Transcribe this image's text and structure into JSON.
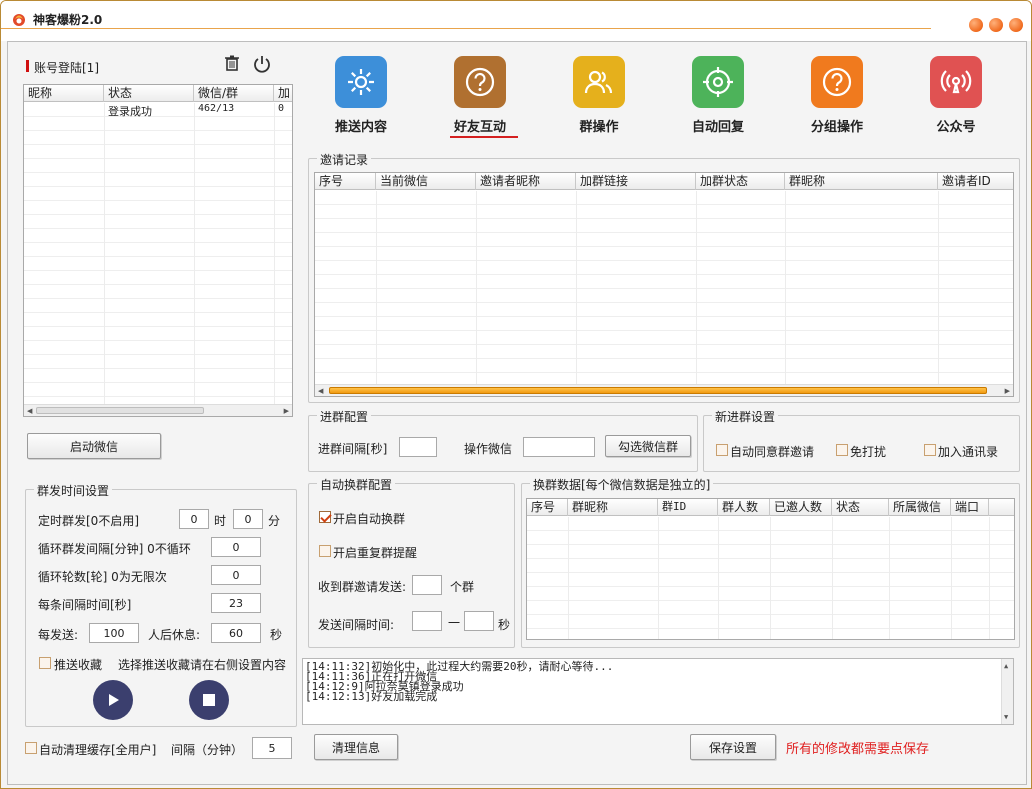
{
  "app": {
    "title": "神客爆粉2.0"
  },
  "account": {
    "label": "账号登陆[1]",
    "columns": [
      "昵称",
      "状态",
      "微信/群",
      "加"
    ],
    "rows": [
      [
        "",
        "登录成功",
        "462/13",
        "0"
      ]
    ],
    "start_button": "启动微信"
  },
  "nav": [
    {
      "label": "推送内容",
      "icon": "gear-icon",
      "color": "#3d8fd9"
    },
    {
      "label": "好友互动",
      "icon": "question-icon",
      "color": "#b07030",
      "active": true
    },
    {
      "label": "群操作",
      "icon": "group-icon",
      "color": "#e5b01c"
    },
    {
      "label": "自动回复",
      "icon": "target-icon",
      "color": "#4db35a"
    },
    {
      "label": "分组操作",
      "icon": "question-icon",
      "color": "#f07a1e"
    },
    {
      "label": "公众号",
      "icon": "broadcast-icon",
      "color": "#e05252"
    }
  ],
  "invite_log": {
    "title": "邀请记录",
    "columns": [
      "序号",
      "当前微信",
      "邀请者昵称",
      "加群链接",
      "加群状态",
      "群昵称",
      "邀请者ID"
    ]
  },
  "join_config": {
    "title": "进群配置",
    "interval_label": "进群间隔[秒]",
    "interval_value": "",
    "wechat_label": "操作微信",
    "wechat_value": "",
    "select_button": "勾选微信群"
  },
  "new_group": {
    "title": "新进群设置",
    "options": [
      {
        "label": "自动同意群邀请",
        "checked": false
      },
      {
        "label": "免打扰",
        "checked": false
      },
      {
        "label": "加入通讯录",
        "checked": false
      }
    ]
  },
  "schedule": {
    "title": "群发时间设置",
    "timed_label": "定时群发[0不启用]",
    "hour_value": "0",
    "hour_unit": "时",
    "minute_value": "0",
    "minute_unit": "分",
    "loop_interval_label": "循环群发间隔[分钟] 0不循环",
    "loop_interval_value": "0",
    "loop_rounds_label": "循环轮数[轮] 0为无限次",
    "loop_rounds_value": "0",
    "per_interval_label": "每条间隔时间[秒]",
    "per_interval_value": "23",
    "per_send_label": "每发送:",
    "per_send_value": "100",
    "rest_label": "人后休息:",
    "rest_value": "60",
    "rest_unit": "秒",
    "push_fav_label": "推送收藏",
    "push_fav_checked": false,
    "push_fav_hint": "选择推送收藏请在右侧设置内容"
  },
  "auto_switch": {
    "title": "自动换群配置",
    "enable_label": "开启自动换群",
    "enable_checked": true,
    "repeat_label": "开启重复群提醒",
    "repeat_checked": false,
    "invite_label": "收到群邀请发送:",
    "invite_value": "",
    "invite_unit": "个群",
    "interval_label": "发送间隔时间:",
    "interval_from": "",
    "interval_sep": "一",
    "interval_to": "",
    "interval_unit": "秒"
  },
  "switch_data": {
    "title": "换群数据[每个微信数据是独立的]",
    "columns": [
      "序号",
      "群昵称",
      "群ID",
      "群人数",
      "已邀人数",
      "状态",
      "所属微信",
      "端口"
    ]
  },
  "log_lines": [
    "[14:11:32]初始化中，此过程大约需要20秒，请耐心等待...",
    "[14:11:36]正在打开微信",
    "[14:12:9]阿拉奈莫镇登录成功",
    "[14:12:13]好友加载完成"
  ],
  "bottom": {
    "auto_clear_label": "自动清理缓存[全用户]",
    "auto_clear_checked": false,
    "interval_label": "间隔（分钟）",
    "interval_value": "5",
    "clear_button": "清理信息",
    "save_button": "保存设置",
    "save_hint": "所有的修改都需要点保存",
    "save_hint_color": "#e02020"
  }
}
